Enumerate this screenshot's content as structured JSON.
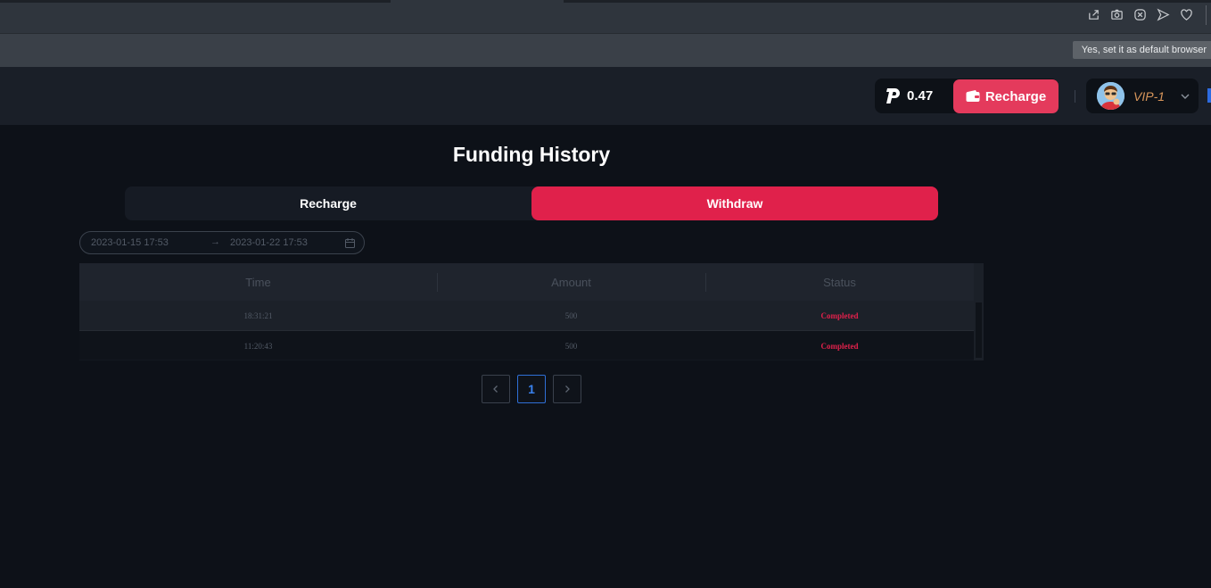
{
  "browser": {
    "tooltip": "Yes, set it as default browser",
    "icons": [
      "share-icon",
      "camera-icon",
      "close-circle-icon",
      "send-icon",
      "heart-icon"
    ]
  },
  "header": {
    "balance": "0.47",
    "recharge_label": "Recharge",
    "vip_label": "VIP-1",
    "accent": "#e43a5c"
  },
  "main": {
    "title": "Funding History",
    "tabs": [
      {
        "label": "Recharge",
        "active": false
      },
      {
        "label": "Withdraw",
        "active": true
      }
    ],
    "range": {
      "from": "2023-01-15 17:53",
      "to": "2023-01-22 17:53"
    },
    "table": {
      "headers": [
        "Time",
        "Amount",
        "Status"
      ],
      "rows": [
        {
          "time": "18:31:21",
          "amount": "500",
          "status": "Completed"
        },
        {
          "time": "11:20:43",
          "amount": "500",
          "status": "Completed"
        }
      ]
    },
    "pagination": {
      "current": "1"
    }
  }
}
